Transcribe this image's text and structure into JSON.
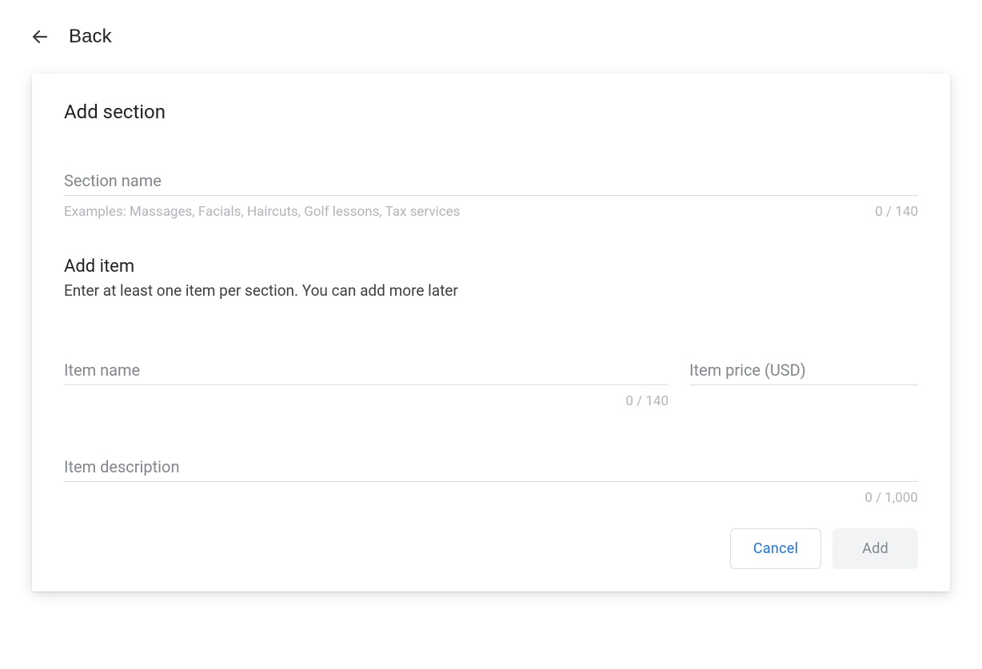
{
  "header": {
    "back_label": "Back"
  },
  "card": {
    "title": "Add section",
    "section_name": {
      "placeholder": "Section name",
      "value": "",
      "helper": "Examples: Massages, Facials, Haircuts, Golf lessons, Tax services",
      "counter": "0 / 140"
    },
    "add_item": {
      "title": "Add item",
      "subtitle": "Enter at least one item per section. You can add more later"
    },
    "item_name": {
      "placeholder": "Item name",
      "value": "",
      "counter": "0 / 140"
    },
    "item_price": {
      "placeholder": "Item price (USD)",
      "value": ""
    },
    "item_description": {
      "placeholder": "Item description",
      "value": "",
      "counter": "0 / 1,000"
    },
    "actions": {
      "cancel": "Cancel",
      "add": "Add"
    }
  }
}
